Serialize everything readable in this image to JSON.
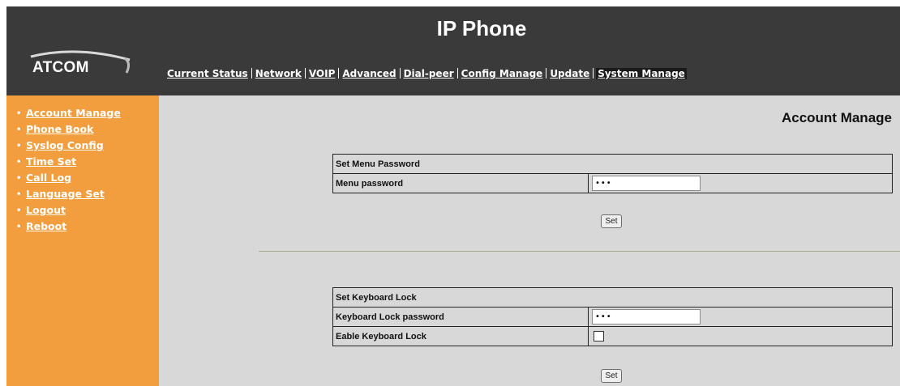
{
  "header": {
    "title": "IP Phone",
    "logo_text": "ATCOM"
  },
  "topnav": [
    {
      "label": "Current Status",
      "active": false
    },
    {
      "label": "Network",
      "active": false
    },
    {
      "label": "VOIP",
      "active": false
    },
    {
      "label": "Advanced",
      "active": false
    },
    {
      "label": "Dial-peer",
      "active": false
    },
    {
      "label": "Config Manage",
      "active": false
    },
    {
      "label": "Update",
      "active": false
    },
    {
      "label": "System Manage",
      "active": true
    }
  ],
  "sidebar": {
    "items": [
      {
        "label": "Account Manage"
      },
      {
        "label": "Phone Book"
      },
      {
        "label": "Syslog Config"
      },
      {
        "label": "Time Set"
      },
      {
        "label": "Call Log"
      },
      {
        "label": "Language Set"
      },
      {
        "label": "Logout"
      },
      {
        "label": "Reboot"
      }
    ]
  },
  "main": {
    "page_title": "Account Manage",
    "menu_password_section": {
      "heading": "Set Menu Password",
      "field_label": "Menu password",
      "field_value": "•••",
      "set_label": "Set"
    },
    "keyboard_lock_section": {
      "heading": "Set Keyboard Lock",
      "password_label": "Keyboard Lock password",
      "password_value": "•••",
      "enable_label": "Eable Keyboard Lock",
      "enable_checked": false,
      "set_label": "Set"
    }
  },
  "colors": {
    "header_bg": "#3a3a3a",
    "sidebar_bg": "#f29e3e",
    "content_bg": "#d8d8d8"
  }
}
